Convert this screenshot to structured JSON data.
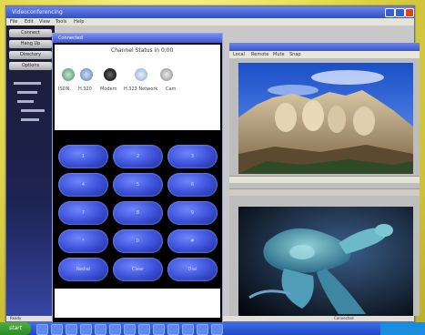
{
  "window": {
    "title": "Videoconferencing"
  },
  "menubar": {
    "items": [
      "File",
      "Edit",
      "View",
      "Tools",
      "Help"
    ]
  },
  "sidebar": {
    "buttons": [
      "Connect",
      "Hang Up",
      "Directory",
      "Options"
    ],
    "tree_items": [
      "",
      "",
      "",
      "",
      ""
    ]
  },
  "dialer": {
    "title": "Connected",
    "display": "Channel Status in 0:00",
    "status_labels": [
      "ISDN",
      "H.320",
      "Modem",
      "H.323 Network",
      "Cam"
    ],
    "keys": [
      "1",
      "2",
      "3",
      "4",
      "5",
      "6",
      "7",
      "8",
      "9",
      "*",
      "0",
      "#",
      "Redial",
      "Clear",
      "Dial"
    ]
  },
  "right_pane": {
    "toolbar": [
      "Local",
      "Remote",
      "Mute",
      "Snap"
    ]
  },
  "statusbar": {
    "left": "Ready",
    "right": "Connected"
  },
  "taskbar": {
    "start": "start",
    "clock": ""
  }
}
